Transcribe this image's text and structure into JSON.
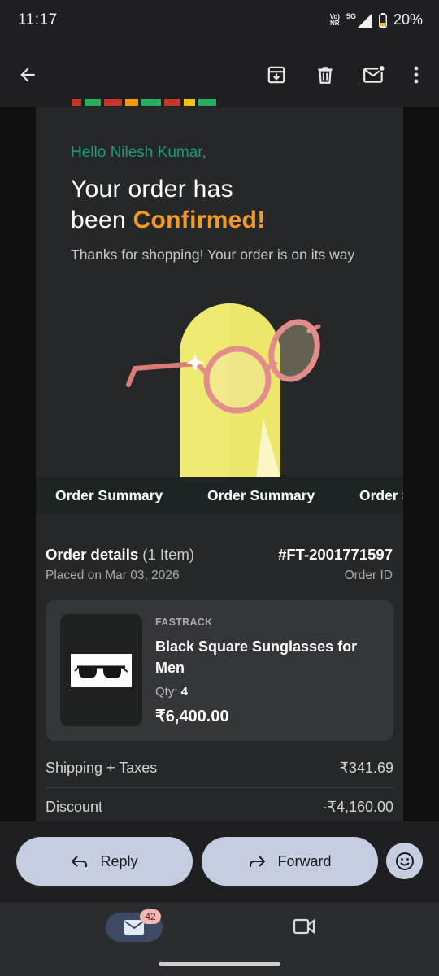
{
  "status_bar": {
    "time": "11:17",
    "network_top": "Vo)",
    "network_bottom": "NR",
    "network_type": "5G",
    "battery": "20%"
  },
  "app_bar": {
    "icons": [
      "arrow-back-icon",
      "archive-icon",
      "delete-icon",
      "mark-unread-icon",
      "more-vert-icon"
    ]
  },
  "email": {
    "greeting": "Hello Nilesh Kumar,",
    "headline_line1": "Your order has",
    "headline_line2_prefix": "been ",
    "headline_highlight": "Confirmed!",
    "thanks": "Thanks for shopping! Your order is on its way",
    "ticker_items": [
      "Order Summary",
      "Order Summary",
      "Order Summary"
    ],
    "order_details": {
      "title": "Order details",
      "item_count": "(1 Item)",
      "order_number": "#FT-2001771597",
      "placed": "Placed on Mar 03, 2026",
      "id_label": "Order ID"
    },
    "product": {
      "brand": "FASTRACK",
      "name": "Black Square Sunglasses for Men",
      "qty_label": "Qty: ",
      "qty_value": "4",
      "price": "₹6,400.00"
    },
    "summary_rows": [
      {
        "label": "Shipping + Taxes",
        "value": "₹341.69"
      },
      {
        "label": "Discount",
        "value": "-₹4,160.00"
      }
    ]
  },
  "actions": {
    "reply": "Reply",
    "forward": "Forward"
  },
  "bottom_nav": {
    "mail_badge": "42"
  },
  "colors": {
    "accent_green": "#1a9b7a",
    "accent_orange": "#f39a22",
    "pill_bg": "#c5cde0"
  }
}
